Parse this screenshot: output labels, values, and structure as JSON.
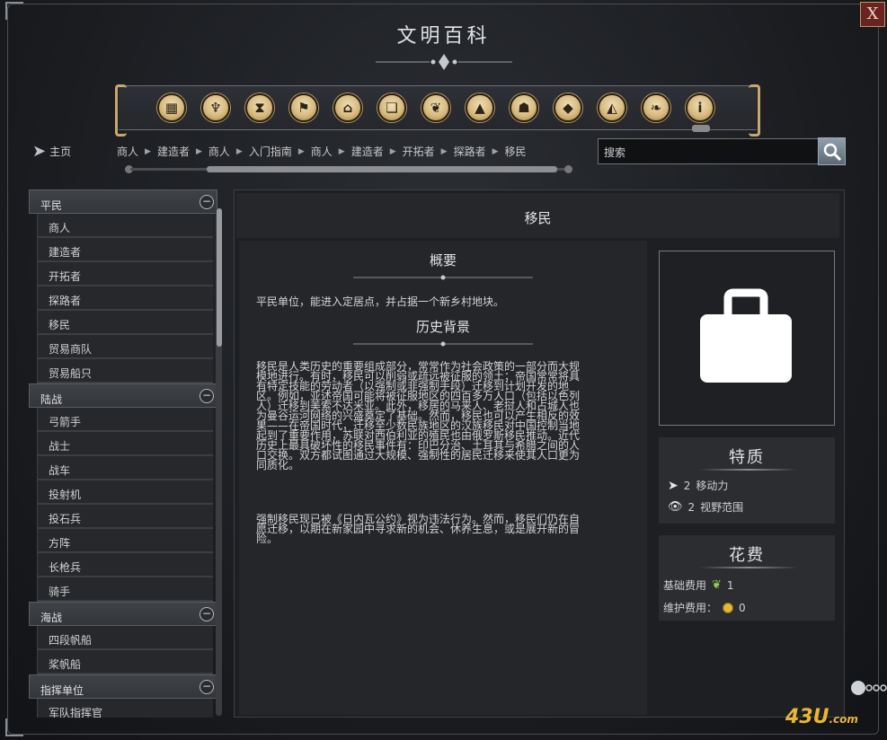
{
  "window": {
    "title": "文明百科",
    "close_label": "X"
  },
  "categories": [
    {
      "icon": "buildings-icon",
      "glyph": "▦"
    },
    {
      "icon": "goblet-icon",
      "glyph": "♆"
    },
    {
      "icon": "hourglass-icon",
      "glyph": "⧗"
    },
    {
      "icon": "flag-icon",
      "glyph": "⚑"
    },
    {
      "icon": "government-icon",
      "glyph": "⌂"
    },
    {
      "icon": "book-icon",
      "glyph": "❏"
    },
    {
      "icon": "leaf-icon",
      "glyph": "❦"
    },
    {
      "icon": "mountain-icon",
      "glyph": "▲"
    },
    {
      "icon": "lantern-icon",
      "glyph": "☗"
    },
    {
      "icon": "diamond-arrow-icon",
      "glyph": "◆"
    },
    {
      "icon": "pyramid-icon",
      "glyph": "◭"
    },
    {
      "icon": "dove-icon",
      "glyph": "❧"
    },
    {
      "icon": "info-icon",
      "glyph": "i"
    }
  ],
  "nav": {
    "home_label": "主页"
  },
  "breadcrumbs": [
    "商人",
    "建造者",
    "商人",
    "入门指南",
    "商人",
    "建造者",
    "开拓者",
    "探路者",
    "移民"
  ],
  "search": {
    "placeholder": "搜索"
  },
  "sidebar": {
    "groups": [
      {
        "label": "平民",
        "toggle": "−",
        "items": [
          "商人",
          "建造者",
          "开拓者",
          "探路者",
          "移民",
          "贸易商队",
          "贸易船只"
        ]
      },
      {
        "label": "陆战",
        "toggle": "−",
        "items": [
          "弓箭手",
          "战士",
          "战车",
          "投射机",
          "投石兵",
          "方阵",
          "长枪兵",
          "骑手"
        ]
      },
      {
        "label": "海战",
        "toggle": "−",
        "items": [
          "四段帆船",
          "桨帆船"
        ]
      },
      {
        "label": "指挥单位",
        "toggle": "−",
        "items": [
          "军队指挥官"
        ]
      }
    ]
  },
  "article": {
    "title": "移民",
    "overview_heading": "概要",
    "overview_text": "平民单位，能进入定居点，并占据一个新乡村地块。",
    "history_heading": "历史背景",
    "history_lines": [
      "移民是人类历史的重要组成部分，常常作为社会政策的一部分而大规",
      "模地进行。有时，移民可以削弱或疏远被征服的领土；帝国常常将具",
      "有特定技能的劳动者（以强制或非强制手段）迁移到计划开发的地",
      "区。例如，亚述帝国可能将被征服地区的四百多万人口（包括以色列",
      "人）迁移到美索不达米亚。此外，移居的马来人、老挝人和占城人也",
      "为曼谷运河网络的兴盛奠定了基础。然而，移民也可以产生相反的效",
      "果——在帝国时代，迁移至少数民族地区的汉族移民对中国控制当地",
      "起到了重要作用，苏联对西伯利亚的殖民也由俄罗斯移民推动。近代",
      "历史上最具破坏性的移民事件有：印巴分治、土耳其与希腊之间的人",
      "口交换。双方都试图通过大规模、强制性的居民迁移来使其人口更为",
      "同质化。"
    ],
    "history_lines2": [
      "强制移民现已被《日内瓦公约》视为违法行为。然而，移民们仍在自",
      "愿迁移，以期在新家园中寻求新的机会、休养生息，或是展开新的冒",
      "险。"
    ]
  },
  "traits": {
    "heading": "特质",
    "rows": [
      {
        "icon": "movement-arrow-icon",
        "value": "2",
        "label": "移动力"
      },
      {
        "icon": "eye-icon",
        "value": "2",
        "label": "视野范围"
      }
    ]
  },
  "cost": {
    "heading": "花费",
    "base_label": "基础费用",
    "base_value": "1",
    "upkeep_label": "维护费用：",
    "upkeep_value": "0"
  },
  "watermark": {
    "text": "43U",
    "suffix": ".com"
  }
}
